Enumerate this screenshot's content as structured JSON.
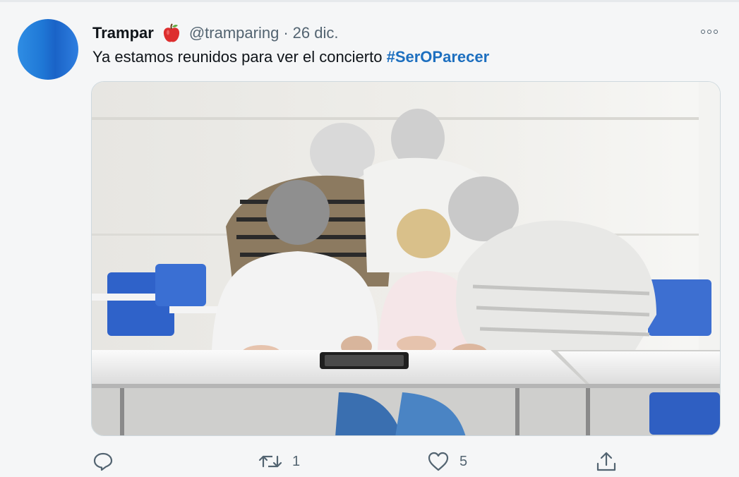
{
  "tweet": {
    "author_name": "Trampar",
    "author_badge_icon": "red-apple-icon",
    "handle": "@tramparing",
    "separator": "·",
    "date": "26 dic.",
    "text": "Ya estamos reunidos para ver el concierto ",
    "hashtag": "#SerOParecer",
    "media_description_icon": "photo",
    "actions": {
      "reply_count": "",
      "retweet_count": "1",
      "like_count": "5",
      "share_count": ""
    }
  },
  "colors": {
    "background": "#f5f6f7",
    "hashtag": "#1d6fbf",
    "secondary_text": "#536471",
    "avatar_blue": "#1f78d6"
  }
}
